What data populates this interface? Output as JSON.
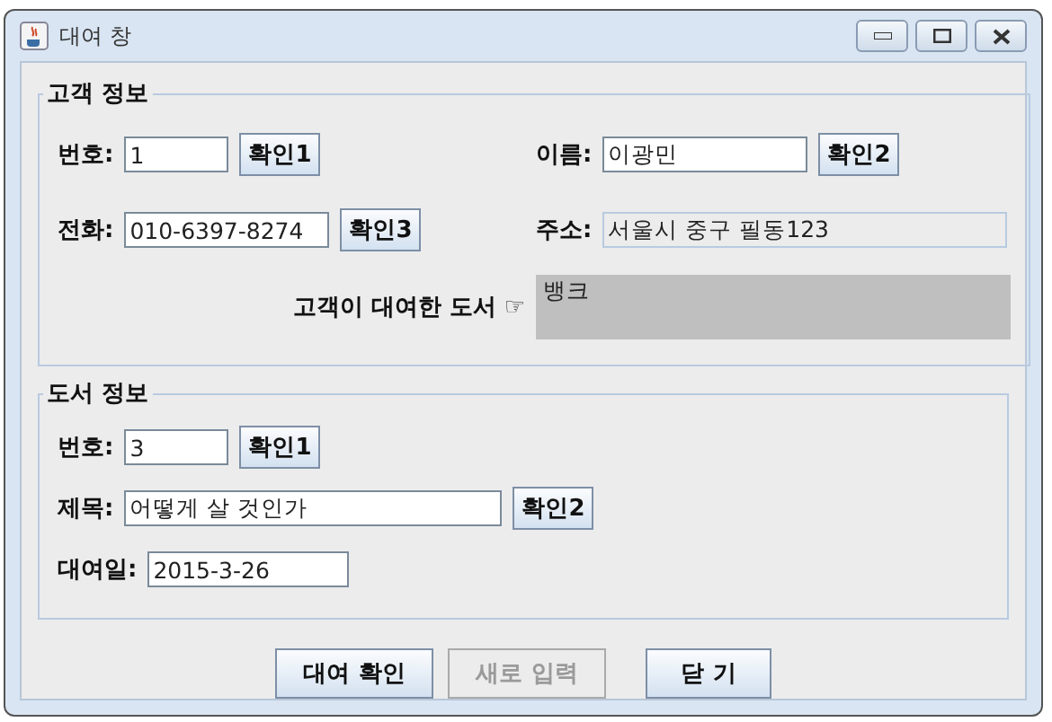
{
  "window": {
    "title": "대여 창"
  },
  "customer_info": {
    "title": "고객 정보",
    "number": {
      "label": "번호:",
      "value": "1",
      "button": "확인1"
    },
    "name": {
      "label": "이름:",
      "value": "이광민",
      "button": "확인2"
    },
    "phone": {
      "label": "전화:",
      "value": "010-6397-8274",
      "button": "확인3"
    },
    "address": {
      "label": "주소:",
      "value": "서울시 중구 필동123",
      "disabled": true
    },
    "rented_books": {
      "label": "고객이 대여한 도서 ☞",
      "items": [
        "뱅크"
      ]
    }
  },
  "book_info": {
    "title": "도서 정보",
    "number": {
      "label": "번호:",
      "value": "3",
      "button": "확인1"
    },
    "book_title": {
      "label": "제목:",
      "value": "어떻게 살 것인가",
      "button": "확인2"
    },
    "rental_date": {
      "label": "대여일:",
      "value": "2015-3-26"
    }
  },
  "buttons": [
    {
      "label": "대여 확인",
      "disabled": false
    },
    {
      "label": "새로 입력",
      "disabled": true
    },
    {
      "label": "닫 기",
      "disabled": false
    }
  ]
}
